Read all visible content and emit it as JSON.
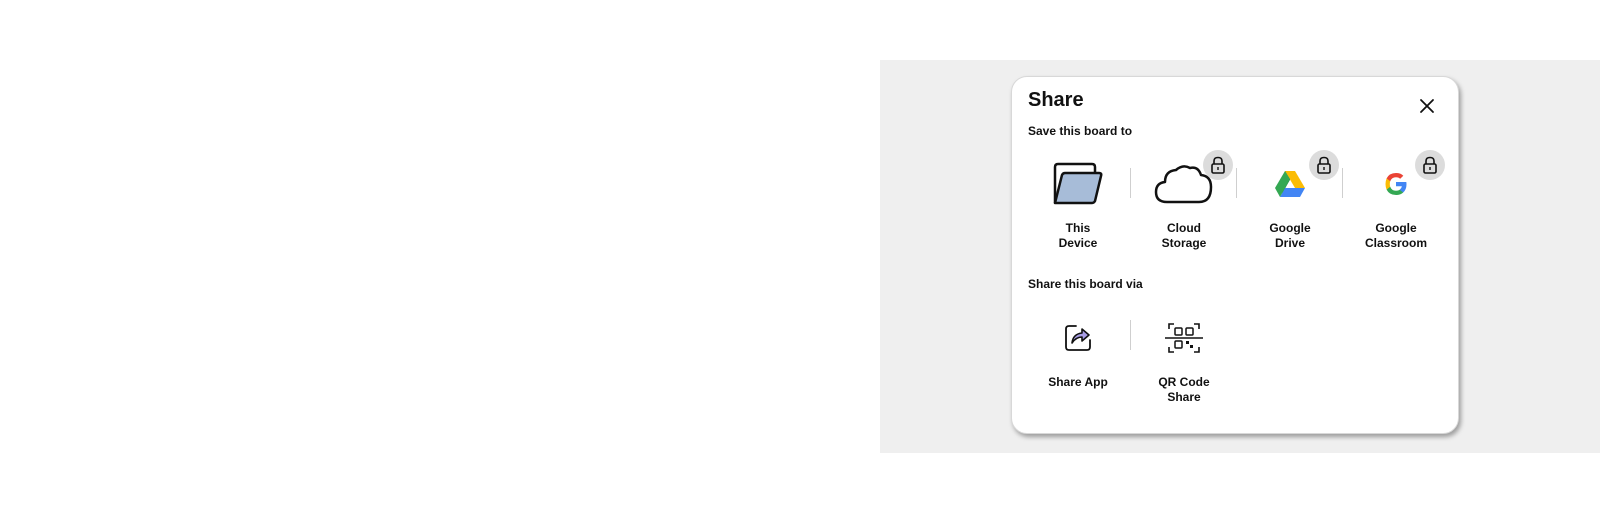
{
  "dialog": {
    "title": "Share",
    "save_section": {
      "label": "Save this board to",
      "options": [
        {
          "label": "This\nDevice",
          "icon": "folder-icon",
          "locked": false
        },
        {
          "label": "Cloud\nStorage",
          "icon": "cloud-icon",
          "locked": true
        },
        {
          "label": "Google\nDrive",
          "icon": "google-drive-icon",
          "locked": true
        },
        {
          "label": "Google\nClassroom",
          "icon": "google-classroom-icon",
          "locked": true
        }
      ]
    },
    "share_section": {
      "label": "Share this board via",
      "options": [
        {
          "label": "Share App",
          "icon": "share-app-icon"
        },
        {
          "label": "QR Code\nShare",
          "icon": "qr-code-icon"
        }
      ]
    }
  },
  "colors": {
    "folder_fill": "#a7bcd8",
    "lock_badge": "#dcdcdc",
    "panel_background": "#efefef",
    "share_arrow": "#a99ee6"
  }
}
